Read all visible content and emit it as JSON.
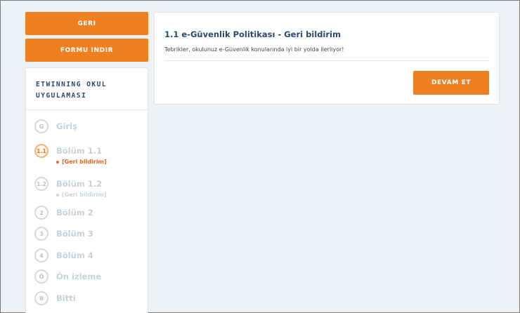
{
  "buttons": {
    "back": "GERI",
    "download_form": "FORMU INDIR",
    "continue": "DEVAM ET"
  },
  "sidebar": {
    "title": "ETWINNING OKUL UYGULAMASI",
    "steps": [
      {
        "badge": "G",
        "label": "Giriş",
        "sub": ""
      },
      {
        "badge": "1.1",
        "label": "Bölüm 1.1",
        "sub": "[Geri bildirim]"
      },
      {
        "badge": "1.2",
        "label": "Bölüm 1.2",
        "sub": "[Geri bildirim]"
      },
      {
        "badge": "2",
        "label": "Bölüm 2",
        "sub": ""
      },
      {
        "badge": "3",
        "label": "Bölüm 3",
        "sub": ""
      },
      {
        "badge": "4",
        "label": "Bölüm 4",
        "sub": ""
      },
      {
        "badge": "Ö",
        "label": "Ön izleme",
        "sub": ""
      },
      {
        "badge": "B",
        "label": "Bitti",
        "sub": ""
      }
    ]
  },
  "card": {
    "title": "1.1 e-Güvenlik Politikası - Geri bildirim",
    "message": "Tebrikler, okulunuz e-Güvenlik konularında iyi bir yolda ilerliyor!"
  },
  "colors": {
    "accent": "#f07f21",
    "active_sub": "#e2661c",
    "title_blue": "#2a4a6b"
  }
}
